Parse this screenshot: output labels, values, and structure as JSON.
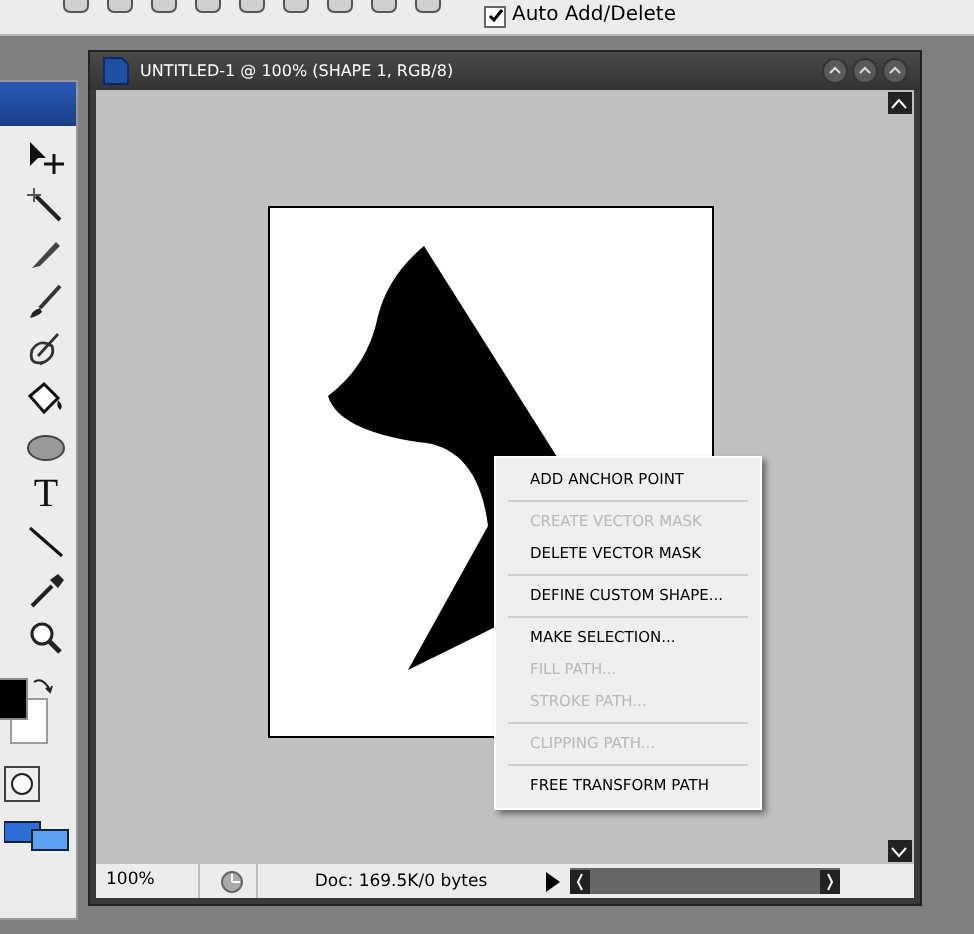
{
  "options_bar": {
    "auto_add_delete": {
      "label": "Auto Add/Delete",
      "checked": true
    }
  },
  "document": {
    "title": "UNTITLED-1 @ 100% (SHAPE 1, RGB/8)",
    "status_bar": {
      "zoom": "100%",
      "doc_info": "Doc: 169.5K/0 bytes"
    }
  },
  "context_menu": {
    "groups": [
      [
        {
          "label": "ADD ANCHOR POINT",
          "disabled": false
        }
      ],
      [
        {
          "label": "CREATE VECTOR MASK",
          "disabled": true
        },
        {
          "label": "DELETE VECTOR MASK",
          "disabled": false
        }
      ],
      [
        {
          "label": "DEFINE CUSTOM SHAPE...",
          "disabled": false
        }
      ],
      [
        {
          "label": "MAKE SELECTION...",
          "disabled": false
        },
        {
          "label": "FILL PATH...",
          "disabled": true
        },
        {
          "label": "STROKE PATH...",
          "disabled": true
        }
      ],
      [
        {
          "label": "CLIPPING PATH...",
          "disabled": true
        }
      ],
      [
        {
          "label": "FREE TRANSFORM PATH",
          "disabled": false
        }
      ]
    ]
  },
  "toolbox": {
    "tools": [
      {
        "kind": "move"
      },
      {
        "kind": "wand"
      },
      {
        "kind": "knife"
      },
      {
        "kind": "brush"
      },
      {
        "kind": "history"
      },
      {
        "kind": "bucket"
      },
      {
        "kind": "blur"
      },
      {
        "kind": "type",
        "glyph": "T"
      },
      {
        "kind": "line"
      },
      {
        "kind": "eyedropper"
      },
      {
        "kind": "zoom"
      }
    ]
  }
}
